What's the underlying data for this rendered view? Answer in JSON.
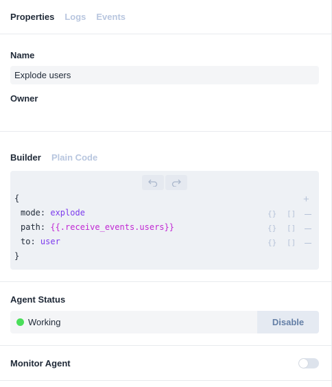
{
  "tabs": {
    "properties": "Properties",
    "logs": "Logs",
    "events": "Events"
  },
  "name": {
    "label": "Name",
    "value": "Explode users"
  },
  "owner": {
    "label": "Owner"
  },
  "editor": {
    "builder": "Builder",
    "plain_code": "Plain Code"
  },
  "code": {
    "open": "{",
    "close": "}",
    "lines": [
      {
        "key": "mode",
        "value": "explode"
      },
      {
        "key": "path",
        "value": "{{.receive_events.users}}"
      },
      {
        "key": "to",
        "value": "user"
      }
    ],
    "obj_icon": "{}",
    "arr_icon": "[]",
    "plus": "+"
  },
  "agent_status": {
    "label": "Agent Status",
    "status": "Working",
    "status_color": "#4ade5a",
    "disable": "Disable"
  },
  "monitor": {
    "label": "Monitor Agent",
    "enabled": false
  },
  "icons": {
    "undo": "undo-icon",
    "redo": "redo-icon"
  }
}
